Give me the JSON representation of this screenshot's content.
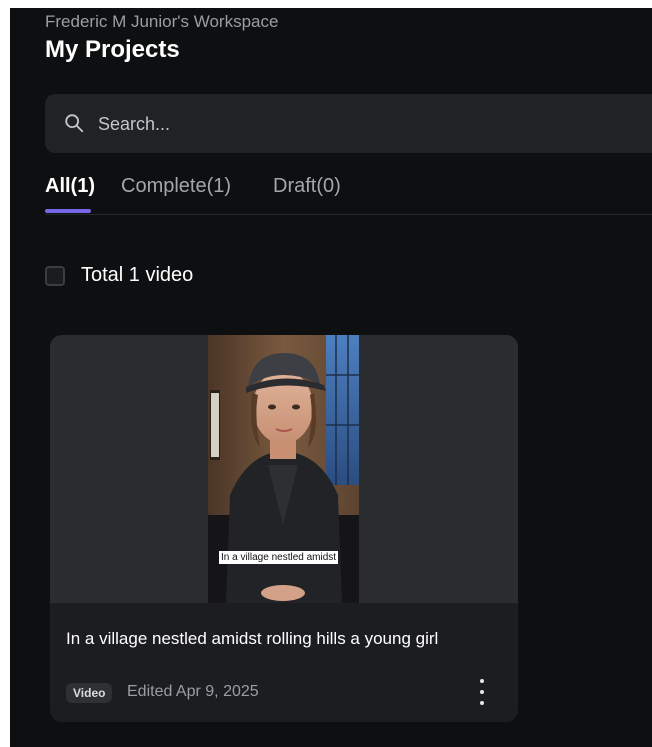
{
  "header": {
    "workspace": "Frederic M Junior's Workspace",
    "title": "My Projects"
  },
  "search": {
    "placeholder": "Search...",
    "icon": "search-icon"
  },
  "tabs": [
    {
      "label": "All(1)",
      "active": true
    },
    {
      "label": "Complete(1)",
      "active": false
    },
    {
      "label": "Draft(0)",
      "active": false
    }
  ],
  "selection": {
    "label": "Total 1 video",
    "checked": false
  },
  "projects": [
    {
      "caption_overlay": "In a village nestled amidst",
      "title": "In a village nestled amidst rolling hills a young girl",
      "type_badge": "Video",
      "edited": "Edited Apr 9, 2025",
      "menu_icon": "more-vertical-icon"
    }
  ],
  "colors": {
    "background": "#0e0f10",
    "accent": "#7468e8",
    "card": "#1c1d20"
  }
}
